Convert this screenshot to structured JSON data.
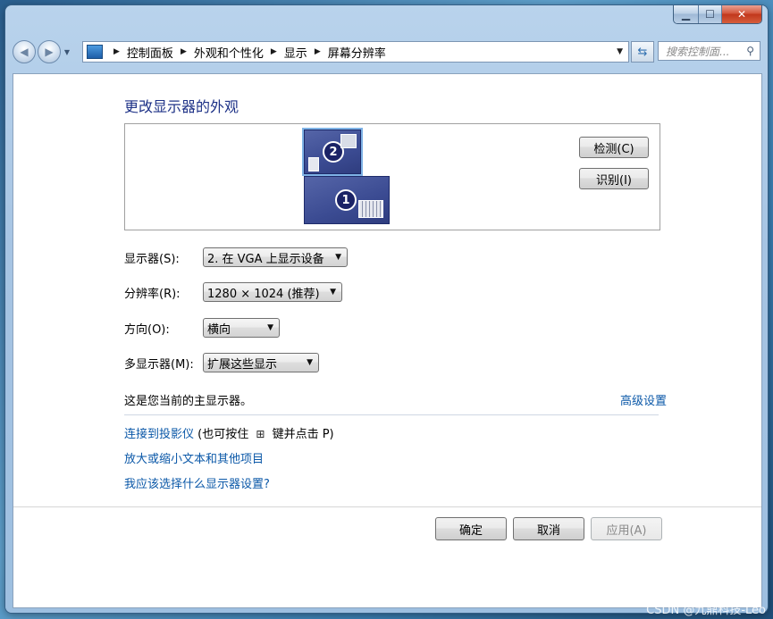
{
  "window": {
    "close_glyph": "✕",
    "min_glyph": "▁",
    "max_glyph": "☐"
  },
  "nav": {
    "breadcrumbs": [
      "控制面板",
      "外观和个性化",
      "显示",
      "屏幕分辨率"
    ],
    "search_placeholder": "搜索控制面..."
  },
  "page": {
    "title": "更改显示器的外观",
    "preview": {
      "monitor_2_label": "2",
      "monitor_1_label": "1",
      "detect_label": "检测(C)",
      "identify_label": "识别(I)"
    },
    "fields": {
      "display_label": "显示器(S):",
      "display_value": "2. 在 VGA 上显示设备",
      "resolution_label": "分辨率(R):",
      "resolution_value": "1280 × 1024 (推荐)",
      "orientation_label": "方向(O):",
      "orientation_value": "横向",
      "multi_label": "多显示器(M):",
      "multi_value": "扩展这些显示"
    },
    "main_display_note": "这是您当前的主显示器。",
    "advanced_link": "高级设置",
    "projector_link": "连接到投影仪",
    "projector_hint_pre": "(也可按住",
    "projector_hint_post": "键并点击 P)",
    "text_size_link": "放大或缩小文本和其他项目",
    "which_settings_link": "我应该选择什么显示器设置?",
    "ok_label": "确定",
    "cancel_label": "取消",
    "apply_label": "应用(A)"
  },
  "watermark": "CSDN @九鼎科技-Leo"
}
